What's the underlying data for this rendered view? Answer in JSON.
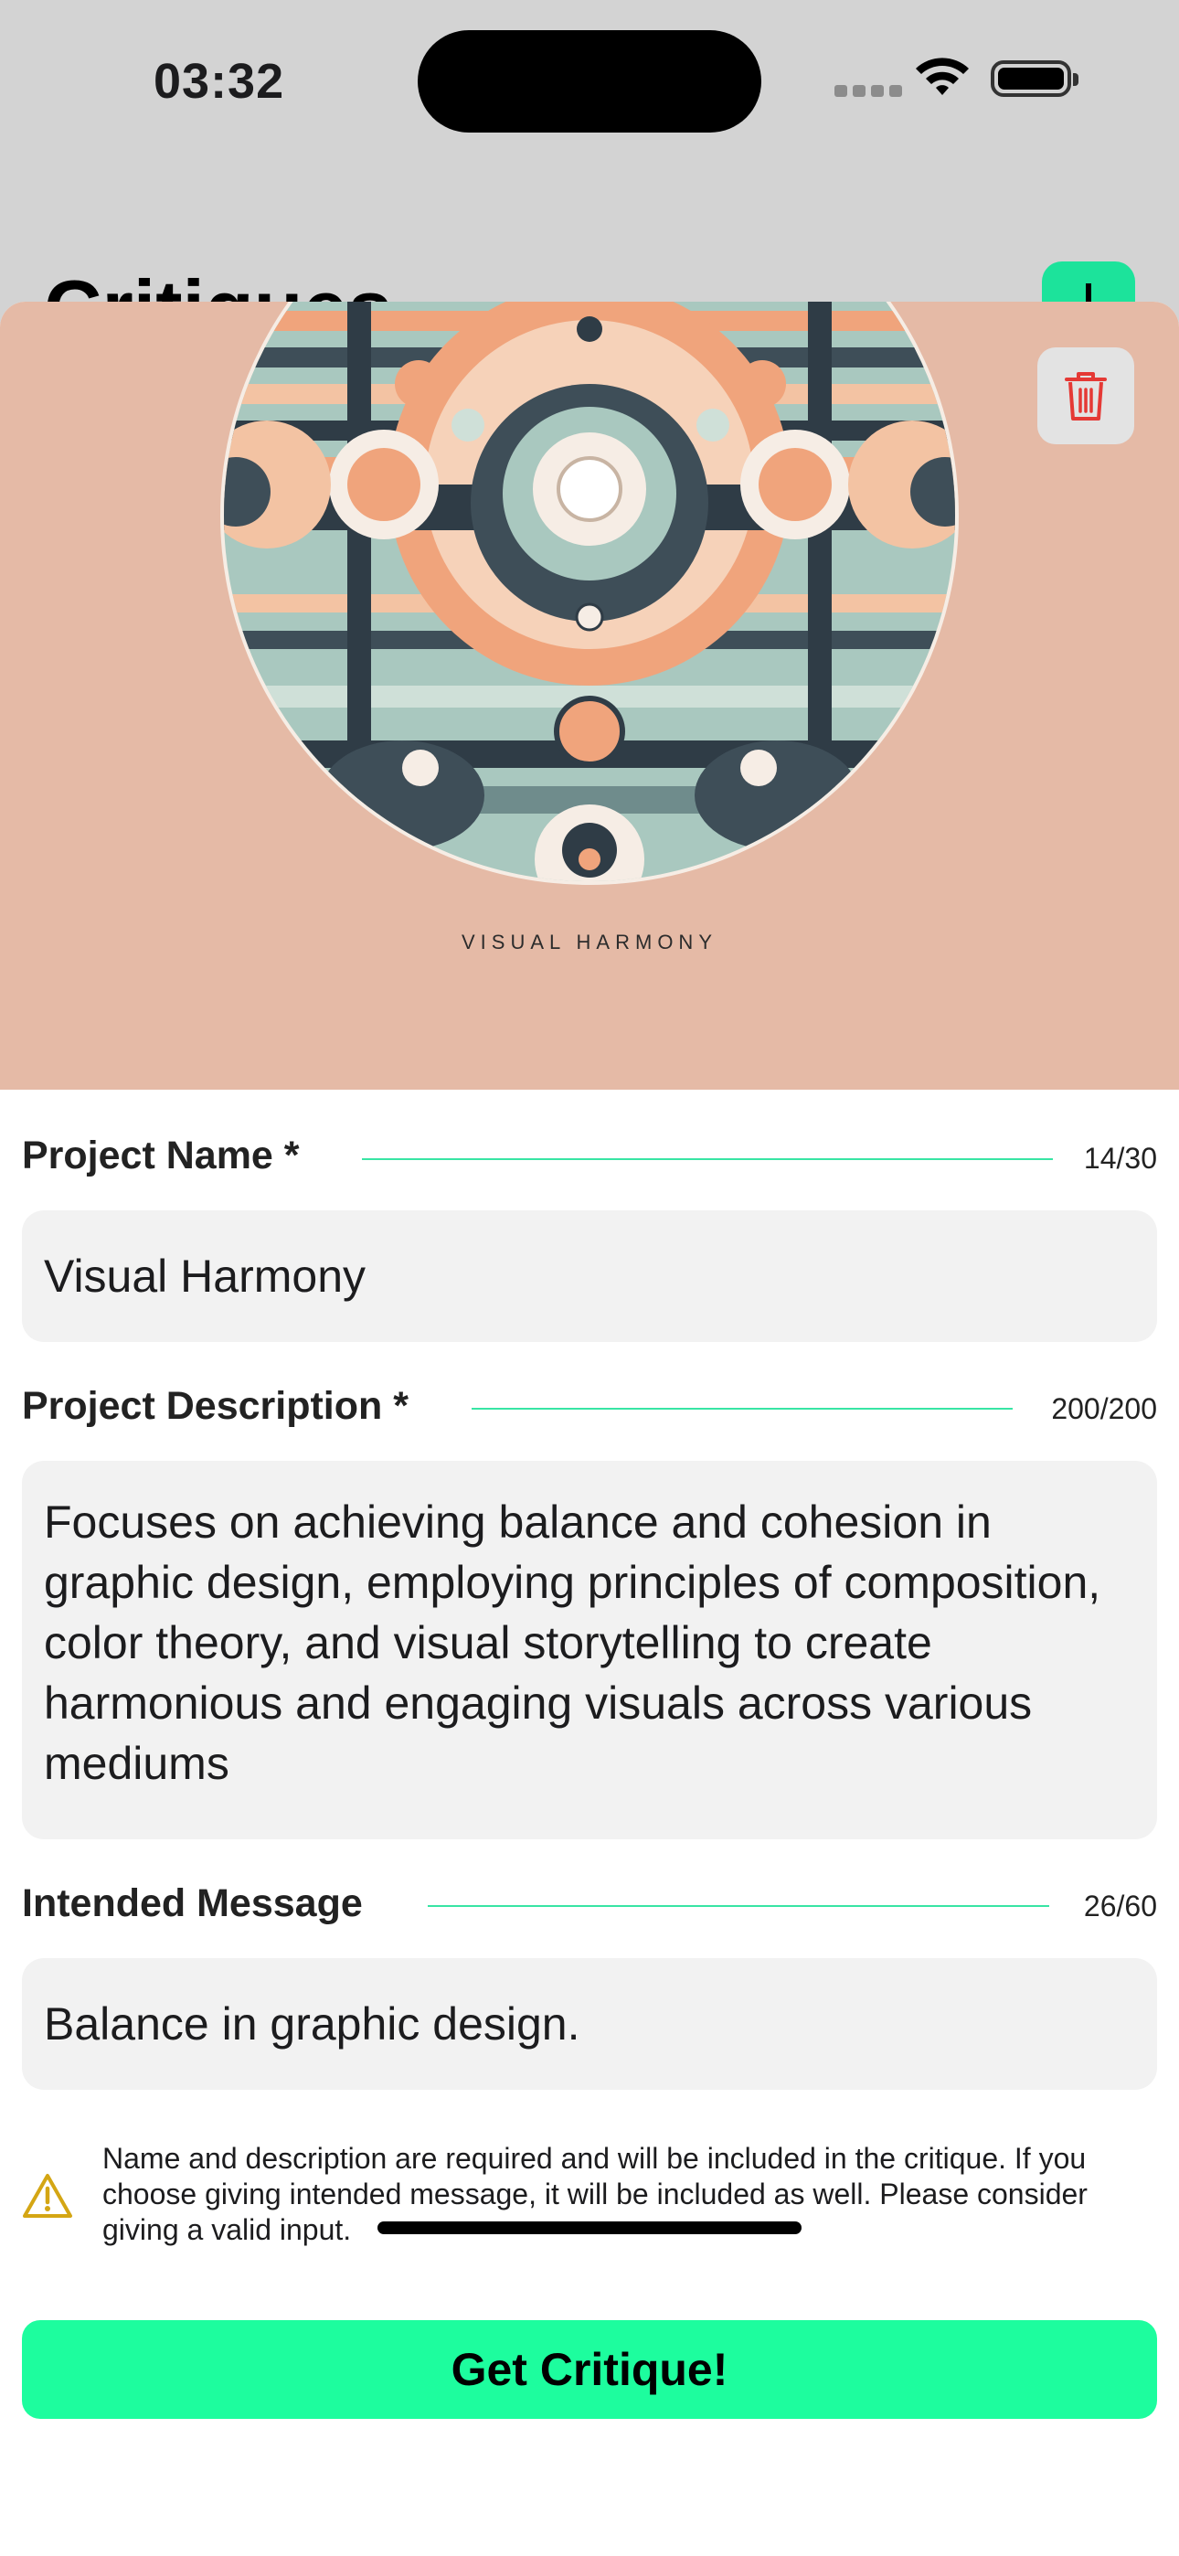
{
  "status_bar": {
    "time": "03:32"
  },
  "background_page": {
    "title": "Critiques"
  },
  "hero": {
    "caption": "VISUAL HARMONY"
  },
  "fields": {
    "name": {
      "label": "Project Name *",
      "count": "14/30",
      "value": "Visual Harmony"
    },
    "description": {
      "label": "Project Description *",
      "count": "200/200",
      "value": "Focuses on achieving balance and cohesion in graphic design, employing principles of composition, color theory, and visual storytelling to create harmonious and engaging visuals across various mediums"
    },
    "message": {
      "label": "Intended Message",
      "count": "26/60",
      "value": "Balance in graphic design."
    }
  },
  "notice": {
    "text": "Name and description are required and will be included in the critique. If you choose giving intended message, it will be included as well. Please consider giving a valid input."
  },
  "cta": {
    "label": "Get Critique!"
  },
  "colors": {
    "accent": "#1dfd9e",
    "hero_bg": "#e5baa6",
    "delete_red": "#e53935",
    "warning": "#d4a614"
  },
  "icons": [
    "wifi-icon",
    "battery-icon",
    "trash-icon",
    "warning-icon",
    "plus-icon"
  ]
}
